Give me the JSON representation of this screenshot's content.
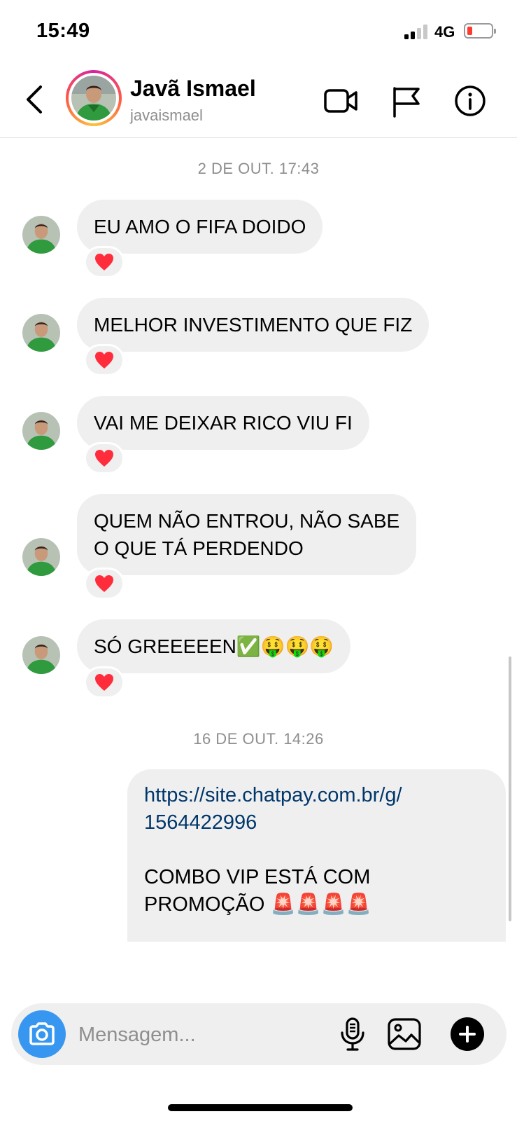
{
  "status_bar": {
    "time": "15:49",
    "network": "4G"
  },
  "header": {
    "name": "Javã Ismael",
    "username": "javaismael"
  },
  "conversation": {
    "timestamp1": "2 DE OUT. 17:43",
    "messages": [
      {
        "text": "EU AMO O FIFA DOIDO",
        "reaction": "heart"
      },
      {
        "text": "MELHOR INVESTIMENTO QUE FIZ",
        "reaction": "heart"
      },
      {
        "text": "VAI ME DEIXAR RICO VIU FI",
        "reaction": "heart"
      },
      {
        "line1": "QUEM NÃO ENTROU, NÃO SABE",
        "line2": "O QUE TÁ PERDENDO",
        "reaction": "heart"
      },
      {
        "text": "SÓ GREEEEEN✅🤑🤑🤑",
        "reaction": "heart"
      }
    ],
    "timestamp2": "16 DE OUT. 14:26",
    "outgoing": {
      "link_line1": "https://site.chatpay.com.br/g/",
      "link_line2": "1564422996",
      "line1": "COMBO VIP ESTÁ COM",
      "line2": "PROMOÇÃO 🚨🚨🚨🚨"
    }
  },
  "composer": {
    "placeholder": "Mensagem..."
  },
  "colors": {
    "bubble": "#efefef",
    "camera_button": "#3797f0",
    "link": "#00376b",
    "reaction_heart": "#ff2d3c"
  },
  "icons": [
    "back-chevron-icon",
    "video-camera-icon",
    "flag-icon",
    "info-icon",
    "camera-icon",
    "microphone-icon",
    "gallery-icon",
    "plus-icon",
    "heart-icon",
    "siren-icon"
  ]
}
